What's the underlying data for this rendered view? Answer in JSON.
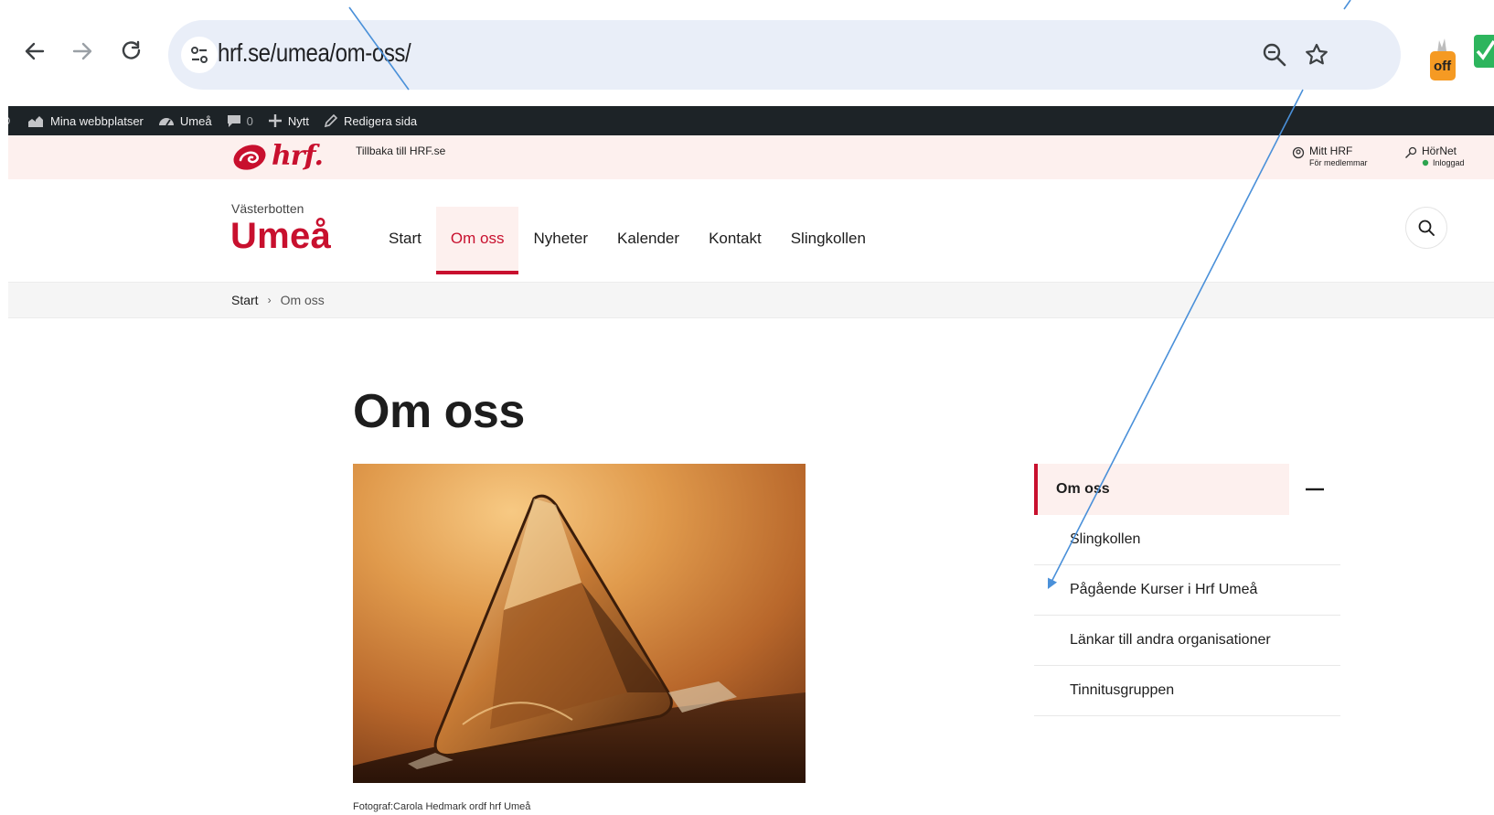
{
  "browser": {
    "url": "hrf.se/umea/om-oss/",
    "extension_badge": "off"
  },
  "admin_bar": {
    "items": [
      {
        "label": "Mina webbplatser"
      },
      {
        "label": "Umeå"
      },
      {
        "label": "0"
      },
      {
        "label": "Nytt"
      },
      {
        "label": "Redigera sida"
      }
    ]
  },
  "top_strip": {
    "logo_text": "hrf.",
    "back_link": "Tillbaka till HRF.se",
    "mitt_hrf": {
      "label": "Mitt HRF",
      "sub": "För medlemmar"
    },
    "hornet": {
      "label": "HörNet",
      "sub": "Inloggad"
    }
  },
  "header": {
    "region": "Västerbotten",
    "site_name": "Umeå",
    "nav": [
      {
        "label": "Start",
        "active": false
      },
      {
        "label": "Om oss",
        "active": true
      },
      {
        "label": "Nyheter",
        "active": false
      },
      {
        "label": "Kalender",
        "active": false
      },
      {
        "label": "Kontakt",
        "active": false
      },
      {
        "label": "Slingkollen",
        "active": false
      }
    ]
  },
  "breadcrumb": {
    "home": "Start",
    "separator": "›",
    "current": "Om oss"
  },
  "content": {
    "title": "Om oss",
    "caption": "Fotograf:Carola Hedmark ordf hrf Umeå"
  },
  "side_menu": {
    "head": "Om oss",
    "items": [
      {
        "label": "Slingkollen"
      },
      {
        "label": "Pågående Kurser i Hrf Umeå"
      },
      {
        "label": "Länkar till andra organisationer"
      },
      {
        "label": "Tinnitusgruppen"
      }
    ]
  },
  "colors": {
    "brand": "#c8102e",
    "tint": "#fdf0ee",
    "admin_bar": "#1d2327",
    "annotation": "#4a90d9"
  }
}
